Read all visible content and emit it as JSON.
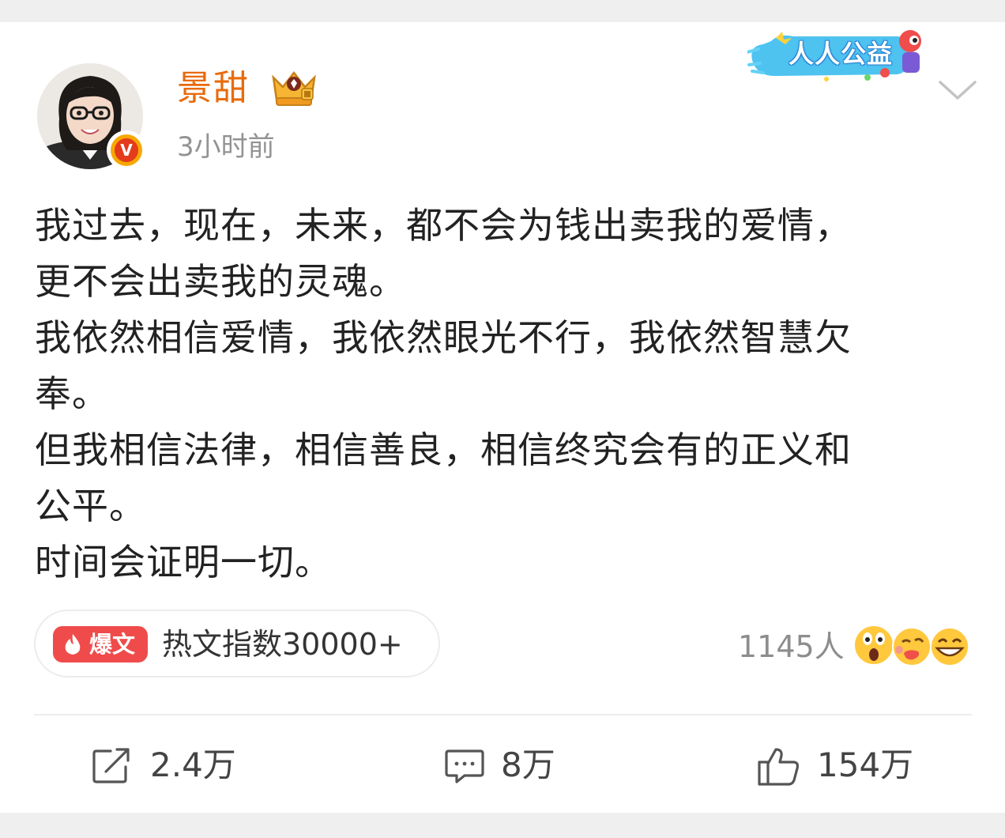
{
  "post": {
    "author": {
      "name": "景甜",
      "verified_badge": "V"
    },
    "timestamp": "3小时前",
    "banner_text": "人人公益",
    "body_lines": [
      "我过去，现在，未来，都不会为钱出卖我的爱情，\n更不会出卖我的灵魂。",
      "我依然相信爱情，我依然眼光不行，我依然智慧欠\n奉。",
      "但我相信法律，相信善良，相信终究会有的正义和\n公平。",
      "时间会证明一切。"
    ],
    "hot": {
      "badge": "爆文",
      "text": "热文指数30000+"
    },
    "reactions": {
      "count": "1145人",
      "emojis": [
        "surprised-emoji-icon",
        "kiss-emoji-icon",
        "grin-emoji-icon"
      ]
    },
    "actions": {
      "share": {
        "icon": "share-icon",
        "count": "2.4万"
      },
      "comment": {
        "icon": "comment-icon",
        "count": "8万"
      },
      "like": {
        "icon": "thumbs-up-icon",
        "count": "154万"
      }
    }
  },
  "colors": {
    "username": "#e86b0c",
    "muted": "#939393",
    "hot_badge": "#f04b4b",
    "body_text": "#222222"
  }
}
